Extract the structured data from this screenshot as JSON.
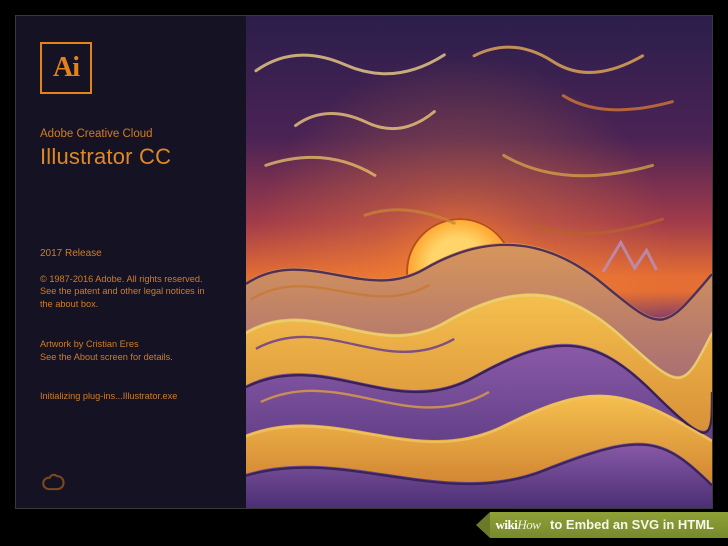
{
  "logo": {
    "text": "Ai"
  },
  "suite_line": "Adobe Creative Cloud",
  "product_name": "Illustrator CC",
  "release_label": "2017 Release",
  "legal_text": "© 1987-2016 Adobe. All rights reserved. See the patent and other legal notices in the about box.",
  "artwork_credit_line1": "Artwork by Cristian Eres",
  "artwork_credit_line2": "See the About screen for details.",
  "status_text": "Initializing plug-ins...Illustrator.exe",
  "cc_icon_name": "creative-cloud-icon",
  "watermark": {
    "brand_prefix": "wiki",
    "brand_suffix": "How",
    "title": " to Embed an SVG in HTML"
  },
  "colors": {
    "accent": "#e4821a",
    "panel_bg": "#151323",
    "wm_bg": "#8fa037"
  }
}
